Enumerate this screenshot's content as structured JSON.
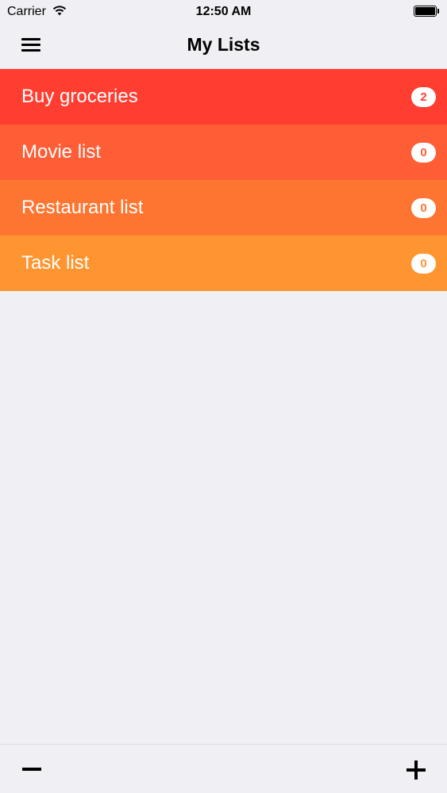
{
  "status_bar": {
    "carrier": "Carrier",
    "time": "12:50 AM",
    "icons": [
      "wifi-icon",
      "battery-icon"
    ]
  },
  "nav": {
    "title": "My Lists",
    "menu_icon": "hamburger-menu-icon"
  },
  "lists": [
    {
      "name": "Buy groceries",
      "count": "2",
      "color": "#ff3e31"
    },
    {
      "name": "Movie list",
      "count": "0",
      "color": "#ff5d36"
    },
    {
      "name": "Restaurant list",
      "count": "0",
      "color": "#fd7530"
    },
    {
      "name": "Task list",
      "count": "0",
      "color": "#fe9530"
    }
  ],
  "toolbar": {
    "remove_icon": "minus-icon",
    "add_icon": "plus-icon"
  },
  "colors": {
    "background": "#efeff4",
    "badge_background": "#ffffff"
  }
}
